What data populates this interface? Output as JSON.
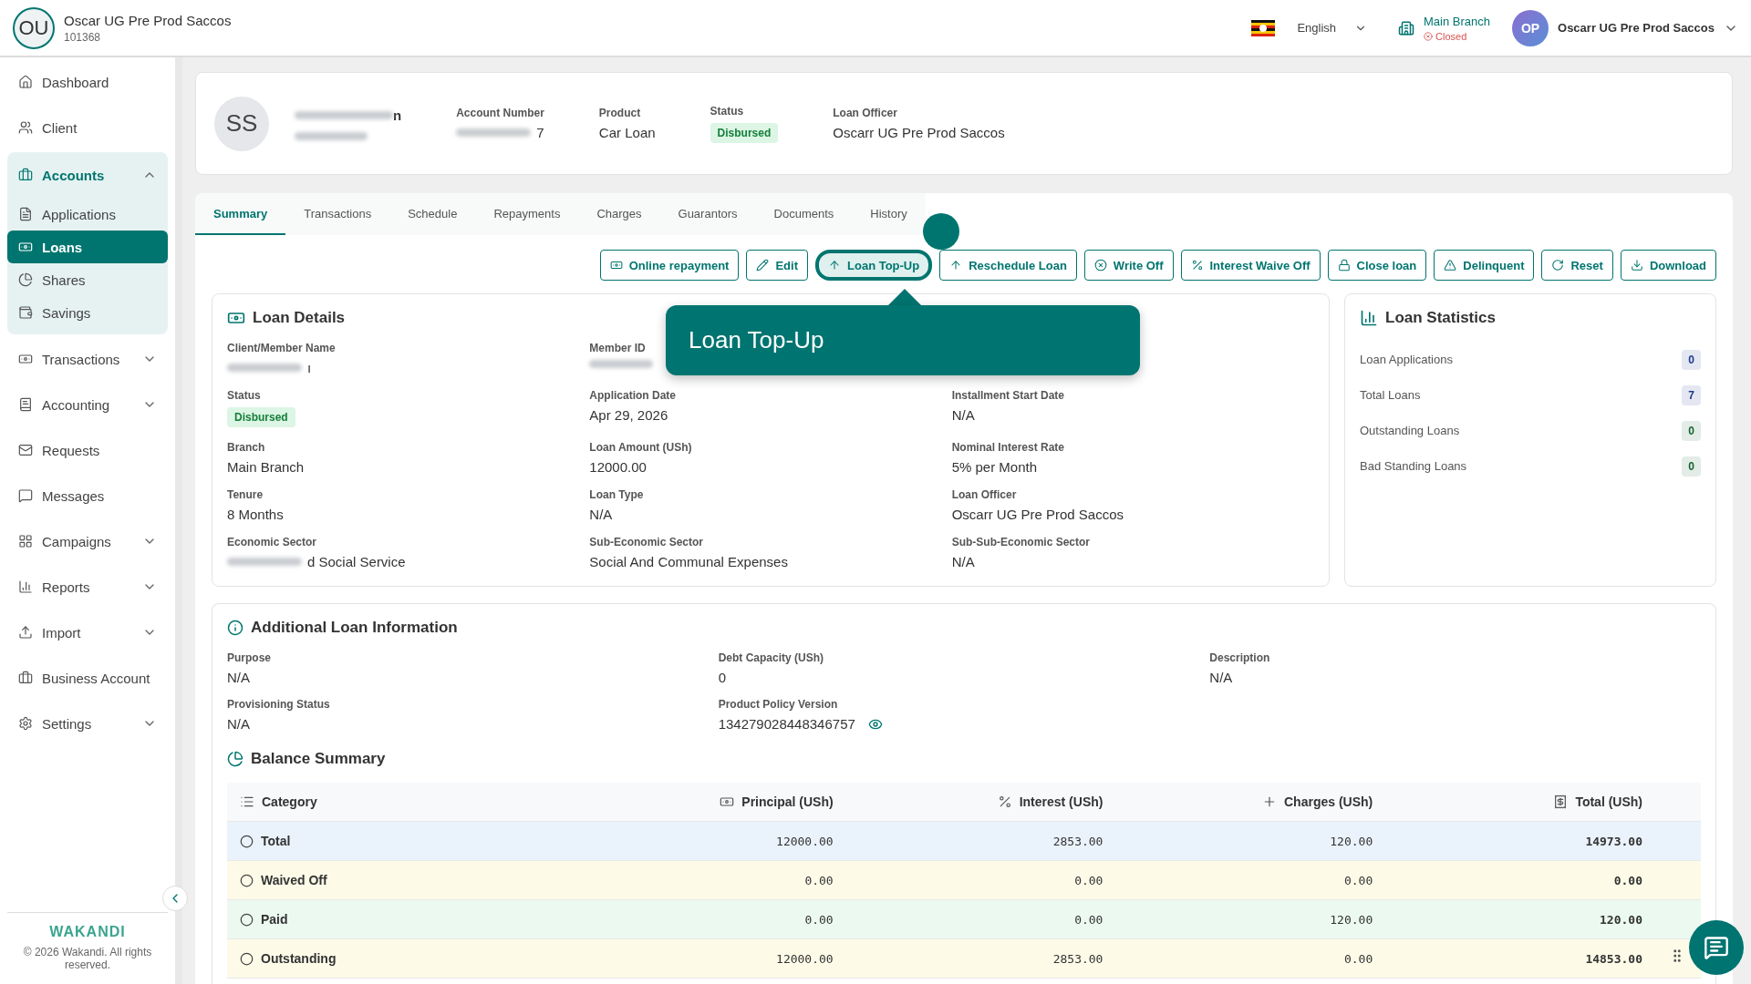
{
  "header": {
    "org_initials": "OU",
    "org_name": "Oscar UG Pre Prod Saccos",
    "org_code": "101368",
    "language": "English",
    "branch_name": "Main Branch",
    "branch_status": "Closed",
    "user_initials": "OP",
    "user_name": "Oscarr UG Pre Prod Saccos"
  },
  "sidebar": {
    "items": [
      {
        "label": "Dashboard",
        "selected": false
      },
      {
        "label": "Client",
        "selected": false
      },
      {
        "label": "Accounts",
        "expanded": true,
        "selected": false,
        "children": [
          {
            "label": "Applications",
            "selected": false
          },
          {
            "label": "Loans",
            "selected": true
          },
          {
            "label": "Shares",
            "selected": false
          },
          {
            "label": "Savings",
            "selected": false
          }
        ]
      },
      {
        "label": "Transactions",
        "expanded": false,
        "selected": false
      },
      {
        "label": "Accounting",
        "expanded": false,
        "selected": false
      },
      {
        "label": "Requests",
        "selected": false
      },
      {
        "label": "Messages",
        "selected": false
      },
      {
        "label": "Campaigns",
        "expanded": false,
        "selected": false
      },
      {
        "label": "Reports",
        "expanded": false,
        "selected": false
      },
      {
        "label": "Import",
        "expanded": false,
        "selected": false
      },
      {
        "label": "Business Account",
        "selected": false
      },
      {
        "label": "Settings",
        "expanded": false,
        "selected": false
      }
    ],
    "brand": "WAKANDI",
    "copyright": "© 2026 Wakandi. All rights reserved."
  },
  "profile": {
    "initials": "SS",
    "name_tail": "n",
    "fields": [
      {
        "label": "Account Number",
        "value": "7",
        "kind": "partly_redacted"
      },
      {
        "label": "Product",
        "value": "Car Loan",
        "kind": "text"
      },
      {
        "label": "Status",
        "value": "Disbursed",
        "kind": "badge"
      },
      {
        "label": "Loan Officer",
        "value": "Oscarr UG Pre Prod Saccos",
        "kind": "text"
      }
    ]
  },
  "tabs": [
    {
      "label": "Summary",
      "selected": true
    },
    {
      "label": "Transactions",
      "selected": false
    },
    {
      "label": "Schedule",
      "selected": false
    },
    {
      "label": "Repayments",
      "selected": false
    },
    {
      "label": "Charges",
      "selected": false
    },
    {
      "label": "Guarantors",
      "selected": false
    },
    {
      "label": "Documents",
      "selected": false
    },
    {
      "label": "History",
      "selected": false
    }
  ],
  "actions": [
    {
      "label": "Online repayment",
      "highlighted": false
    },
    {
      "label": "Edit",
      "highlighted": false
    },
    {
      "label": "Loan Top-Up",
      "highlighted": true
    },
    {
      "label": "Reschedule Loan",
      "highlighted": false
    },
    {
      "label": "Write Off",
      "highlighted": false
    },
    {
      "label": "Interest Waive Off",
      "highlighted": false
    },
    {
      "label": "Close loan",
      "highlighted": false
    },
    {
      "label": "Delinquent",
      "highlighted": false
    },
    {
      "label": "Reset",
      "highlighted": false
    },
    {
      "label": "Download",
      "highlighted": false
    }
  ],
  "tooltip": "Loan Top-Up",
  "loan_details": {
    "title": "Loan Details",
    "rows": [
      [
        {
          "label": "Client/Member Name",
          "value": "ı",
          "kind": "partly_redacted"
        },
        {
          "label": "Member ID",
          "kind": "redacted"
        }
      ],
      [
        {
          "label": "Status",
          "value": "Disbursed",
          "kind": "badge"
        },
        {
          "label": "Application Date",
          "value": "Apr 29, 2026",
          "kind": "text"
        },
        {
          "label": "Installment Start Date",
          "value": "N/A",
          "kind": "text"
        }
      ],
      [
        {
          "label": "Branch",
          "value": "Main Branch",
          "kind": "text"
        },
        {
          "label": "Loan Amount (USh)",
          "value": "12000.00",
          "kind": "text"
        },
        {
          "label": "Nominal Interest Rate",
          "value": "5% per Month",
          "kind": "text"
        }
      ],
      [
        {
          "label": "Tenure",
          "value": "8 Months",
          "kind": "text"
        },
        {
          "label": "Loan Type",
          "value": "N/A",
          "kind": "text"
        },
        {
          "label": "Loan Officer",
          "value": "Oscarr UG Pre Prod Saccos",
          "kind": "text"
        }
      ],
      [
        {
          "label": "Economic Sector",
          "value": "d Social Service",
          "kind": "partly_redacted"
        },
        {
          "label": "Sub-Economic Sector",
          "value": "Social And Communal Expenses",
          "kind": "text"
        },
        {
          "label": "Sub-Sub-Economic Sector",
          "value": "N/A",
          "kind": "text"
        }
      ]
    ]
  },
  "loan_statistics": {
    "title": "Loan Statistics",
    "items": [
      {
        "label": "Loan Applications",
        "value": "0",
        "color": "#1e3a8a"
      },
      {
        "label": "Total Loans",
        "value": "7",
        "color": "#1e3a8a"
      },
      {
        "label": "Outstanding Loans",
        "value": "0",
        "color": "#166534"
      },
      {
        "label": "Bad Standing Loans",
        "value": "0",
        "color": "#166534"
      }
    ]
  },
  "additional_info": {
    "title": "Additional Loan Information",
    "rows": [
      [
        {
          "label": "Purpose",
          "value": "N/A",
          "kind": "text"
        },
        {
          "label": "Debt Capacity (USh)",
          "value": "0",
          "kind": "text"
        },
        {
          "label": "Description",
          "value": "N/A",
          "kind": "text"
        }
      ],
      [
        {
          "label": "Provisioning Status",
          "value": "N/A",
          "kind": "text"
        },
        {
          "label": "Product Policy Version",
          "value": "134279028448346757",
          "kind": "viewable"
        }
      ]
    ]
  },
  "balance_summary": {
    "title": "Balance Summary",
    "columns": [
      "Category",
      "Principal (USh)",
      "Interest (USh)",
      "Charges (USh)",
      "Total (USh)"
    ],
    "rows": [
      {
        "category": "Total",
        "values": [
          "12000.00",
          "2853.00",
          "120.00",
          "14973.00"
        ],
        "color": "#eaf3fc"
      },
      {
        "category": "Waived Off",
        "values": [
          "0.00",
          "0.00",
          "0.00",
          "0.00"
        ],
        "color": "#fdfbe8"
      },
      {
        "category": "Paid",
        "values": [
          "0.00",
          "0.00",
          "120.00",
          "120.00"
        ],
        "color": "#ecf9f1"
      },
      {
        "category": "Outstanding",
        "values": [
          "12000.00",
          "2853.00",
          "0.00",
          "14853.00"
        ],
        "color": "#fdfbe8"
      }
    ]
  }
}
